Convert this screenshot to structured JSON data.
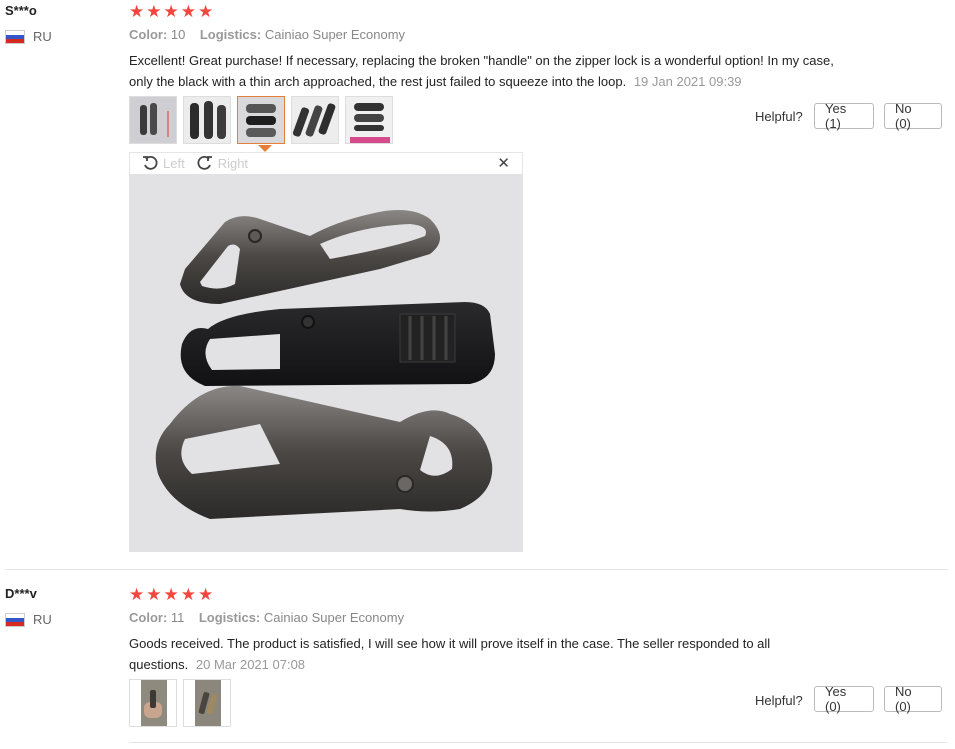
{
  "reviews": [
    {
      "user": "S***o",
      "country": "RU",
      "stars": 5,
      "color_label": "Color:",
      "color_value": "10",
      "logistics_label": "Logistics:",
      "logistics_value": "Cainiao Super Economy",
      "text": "Excellent! Great purchase! If necessary, replacing the broken \"handle\" on the zipper lock is a wonderful option! In my case, only the black with a thin arch approached, the rest just failed to squeeze into the loop.",
      "date": "19 Jan 2021 09:39",
      "helpful_label": "Helpful?",
      "yes_label": "Yes (1)",
      "no_label": "No (0)",
      "viewer": {
        "left_label": "Left",
        "right_label": "Right",
        "close": "✕"
      }
    },
    {
      "user": "D***v",
      "country": "RU",
      "stars": 5,
      "color_label": "Color:",
      "color_value": "11",
      "logistics_label": "Logistics:",
      "logistics_value": "Cainiao Super Economy",
      "text": "Goods received. The product is satisfied, I will see how it will prove itself in the case. The seller responded to all questions.",
      "date": "20 Mar 2021 07:08",
      "helpful_label": "Helpful?",
      "yes_label": "Yes (0)",
      "no_label": "No (0)"
    }
  ],
  "icons": {
    "star": "star-icon",
    "rotate_left": "rotate-left-icon",
    "rotate_right": "rotate-right-icon",
    "close": "close-icon",
    "flag": "russia-flag-icon"
  },
  "colors": {
    "star": "#f2473f",
    "active_thumb": "#e4803a"
  }
}
